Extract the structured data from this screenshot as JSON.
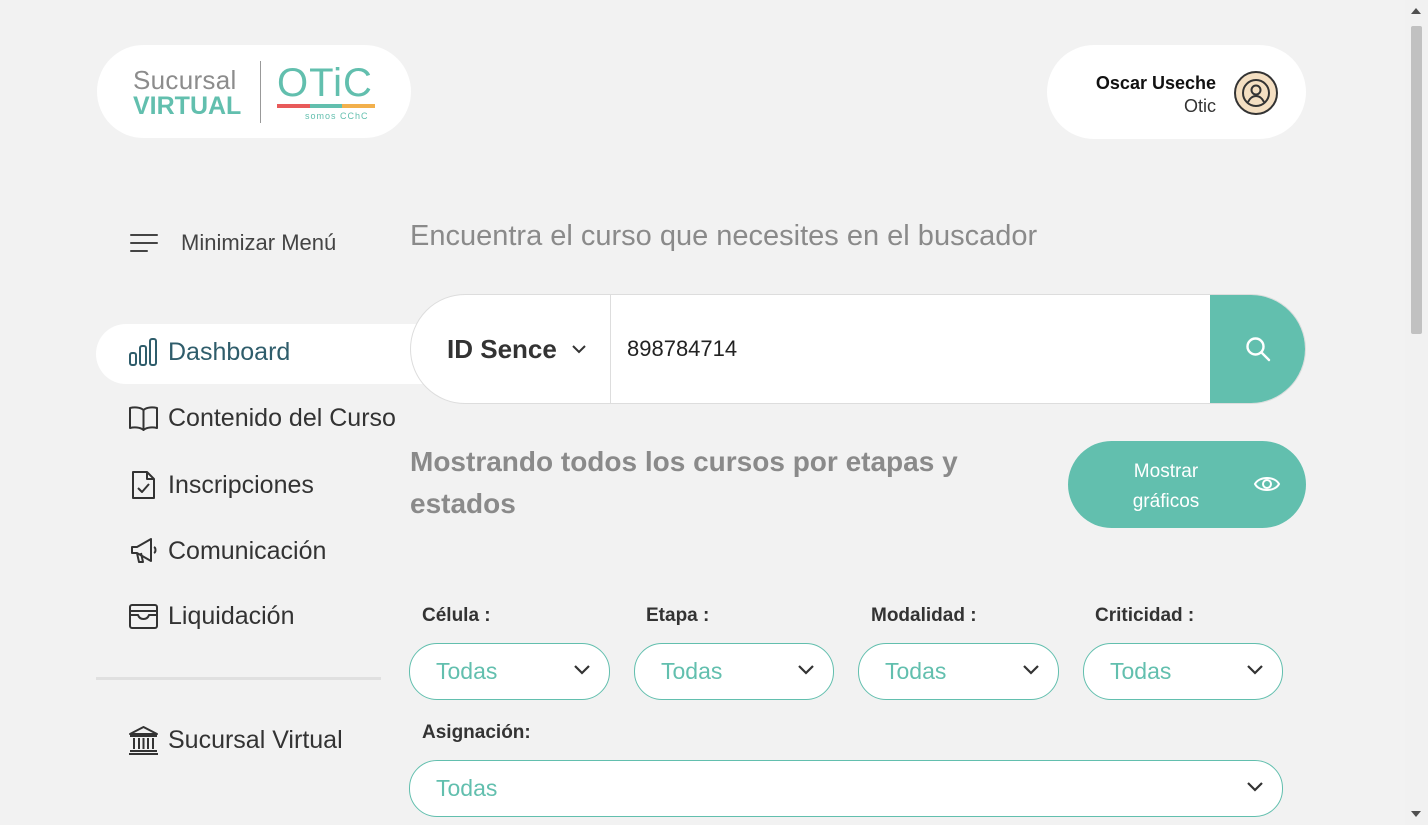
{
  "logo": {
    "sucursal": "Sucursal",
    "virtual": "VIRTUAL",
    "brand": "OTiC",
    "tagline": "somos CChC",
    "bar_colors": [
      "#e85a5a",
      "#62bfae",
      "#f2b04c"
    ]
  },
  "user": {
    "name": "Oscar Useche",
    "organization": "Otic",
    "icon": "user-avatar-icon"
  },
  "sidebar": {
    "minimize_label": "Minimizar Menú",
    "items": [
      {
        "label": "Dashboard",
        "icon": "bar-chart-icon",
        "active": true
      },
      {
        "label": "Contenido del Curso",
        "icon": "book-icon",
        "active": false
      },
      {
        "label": "Inscripciones",
        "icon": "document-check-icon",
        "active": false
      },
      {
        "label": "Comunicación",
        "icon": "megaphone-icon",
        "active": false
      },
      {
        "label": "Liquidación",
        "icon": "wallet-icon",
        "active": false
      }
    ],
    "footer_item": {
      "label": "Sucursal Virtual",
      "icon": "bank-icon"
    }
  },
  "search": {
    "hint": "Encuentra el curso que necesites en el buscador",
    "type_label": "ID Sence",
    "value": "898784714"
  },
  "section": {
    "title": "Mostrando todos los cursos por etapas y estados",
    "show_charts_label": "Mostrar gráficos"
  },
  "filters": {
    "celula": {
      "label": "Célula :",
      "value": "Todas"
    },
    "etapa": {
      "label": "Etapa :",
      "value": "Todas"
    },
    "modalidad": {
      "label": "Modalidad :",
      "value": "Todas"
    },
    "criticidad": {
      "label": "Criticidad :",
      "value": "Todas"
    },
    "asignacion": {
      "label": "Asignación:",
      "value": "Todas"
    }
  },
  "colors": {
    "accent": "#62bfae",
    "background": "#f2f2f2",
    "active_nav_text": "#2f5d6b"
  }
}
